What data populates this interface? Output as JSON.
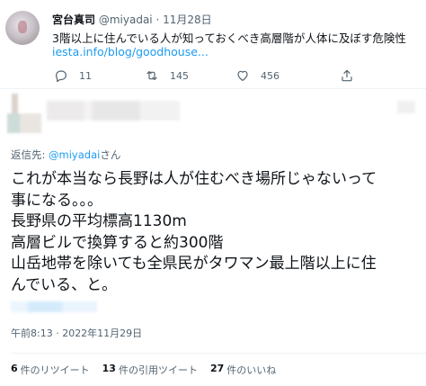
{
  "quoted_tweet": {
    "name": "宮台真司",
    "handle": "@miyadai",
    "separator": "·",
    "date": "11月28日",
    "text": "3階以上に住んでいる人が知っておくべき高層階が人体に及ぼす危険性",
    "link": "iesta.info/blog/goodhouse...",
    "actions": {
      "reply_count": "11",
      "retweet_count": "145",
      "like_count": "456"
    }
  },
  "reply": {
    "reply_to_prefix": "返信先: ",
    "reply_to_mention": "@miyadai",
    "reply_to_suffix": "さん",
    "lines": [
      "これが本当なら長野は人が住むべき場所じゃないって",
      "事になる。。。",
      "長野県の平均標高1130m",
      "高層ビルで換算すると約300階",
      "山岳地帯を除いても全県民がタワマン最上階以上に住",
      "んでいる、と。"
    ],
    "timestamp": "午前8:13 · 2022年11月29日"
  },
  "stats": [
    {
      "count": "6",
      "label": "件のリツイート"
    },
    {
      "count": "13",
      "label": "件の引用ツイート"
    },
    {
      "count": "27",
      "label": "件のいいね"
    }
  ],
  "colors": {
    "text": "#0f1419",
    "secondary": "#536471",
    "link": "#1d9bf0",
    "divider": "#eff3f4"
  },
  "icons": [
    "reply-icon",
    "retweet-icon",
    "like-icon",
    "share-icon"
  ]
}
